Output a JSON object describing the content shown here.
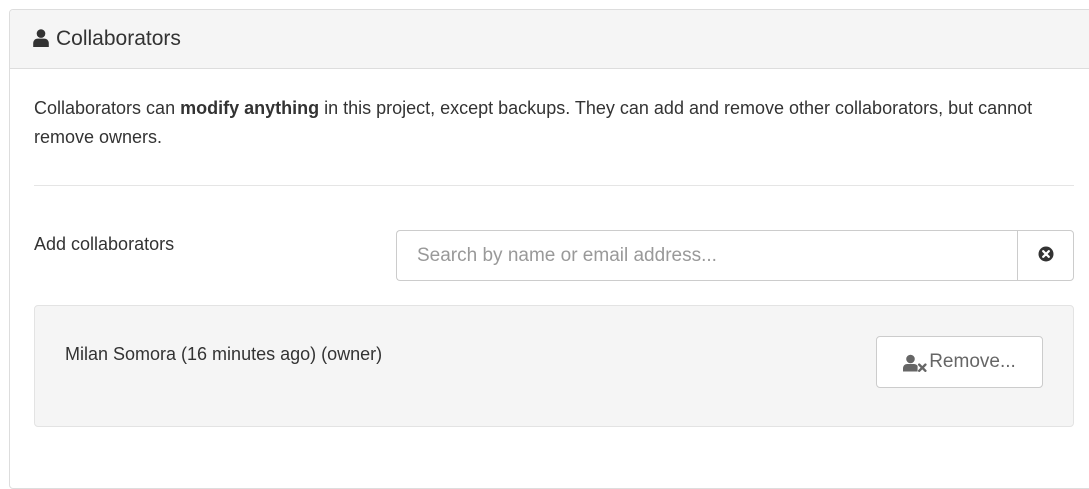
{
  "panel": {
    "title": "Collaborators",
    "title_icon": "user-icon"
  },
  "description": {
    "before": "Collaborators can ",
    "bold": "modify anything",
    "after": " in this project, except backups. They can add and remove other collaborators, but cannot remove owners."
  },
  "add_collaborators": {
    "label": "Add collaborators",
    "search_placeholder": "Search by name or email address...",
    "search_value": "",
    "clear_icon": "times-circle-icon"
  },
  "collaborators": [
    {
      "name": "Milan Somora (16 minutes ago) (owner)",
      "remove_label": "Remove...",
      "remove_icon": "user-times-icon"
    }
  ],
  "colors": {
    "heading_bg": "#f5f5f5",
    "border": "#dddddd",
    "text": "#333333",
    "well_bg": "#f5f5f5"
  }
}
